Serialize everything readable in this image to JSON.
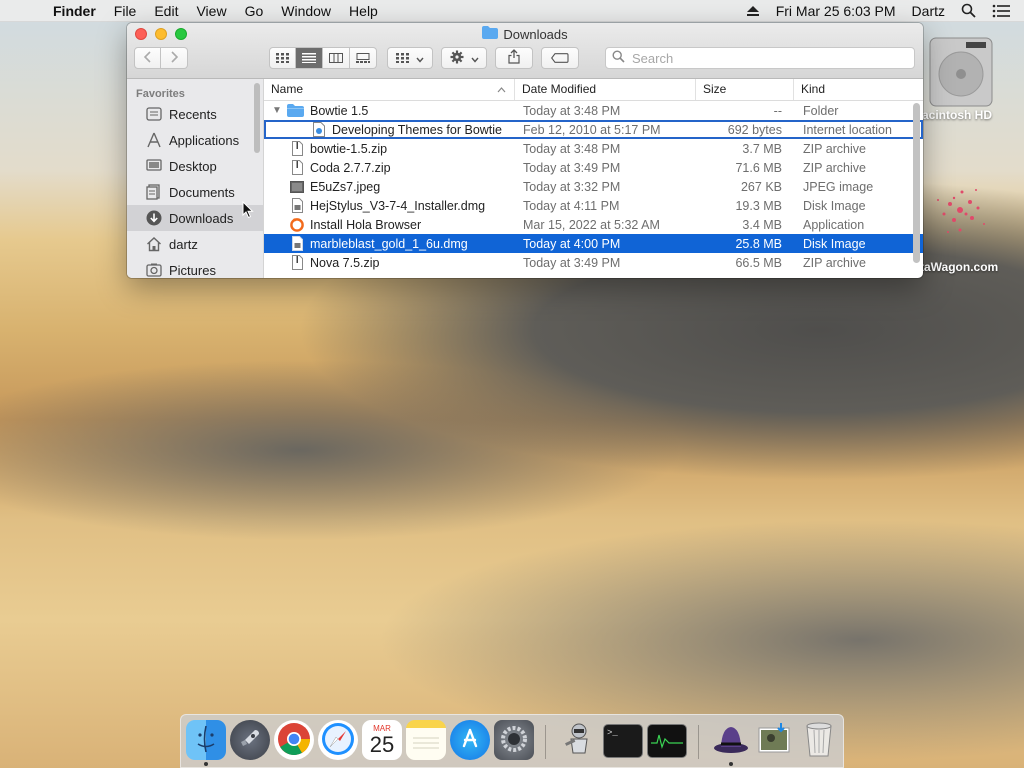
{
  "menubar": {
    "apple_glyph": "",
    "app_name": "Finder",
    "menus": [
      "File",
      "Edit",
      "View",
      "Go",
      "Window",
      "Help"
    ],
    "clock": "Fri Mar 25  6:03 PM",
    "user": "Dartz"
  },
  "desktop": {
    "disk_label": "acintosh HD",
    "watermark": "taWagon.com"
  },
  "window": {
    "title": "Downloads",
    "search_placeholder": "Search",
    "sidebar": {
      "header": "Favorites",
      "items": [
        {
          "label": "Recents",
          "icon": "recents-icon"
        },
        {
          "label": "Applications",
          "icon": "applications-icon"
        },
        {
          "label": "Desktop",
          "icon": "desktop-icon"
        },
        {
          "label": "Documents",
          "icon": "documents-icon"
        },
        {
          "label": "Downloads",
          "icon": "downloads-icon",
          "selected": true
        },
        {
          "label": "dartz",
          "icon": "home-icon"
        },
        {
          "label": "Pictures",
          "icon": "pictures-icon"
        }
      ]
    },
    "columns": [
      "Name",
      "Date Modified",
      "Size",
      "Kind"
    ],
    "rows": [
      {
        "name": "Bowtie 1.5",
        "date": "Today at 3:48 PM",
        "size": "--",
        "kind": "Folder",
        "type": "folder",
        "disclosure": "▼"
      },
      {
        "name": "Developing Themes for Bowtie",
        "date": "Feb 12, 2010 at 5:17 PM",
        "size": "692 bytes",
        "kind": "Internet location",
        "type": "location"
      },
      {
        "name": "bowtie-1.5.zip",
        "date": "Today at 3:48 PM",
        "size": "3.7 MB",
        "kind": "ZIP archive",
        "type": "zip"
      },
      {
        "name": "Coda 2.7.7.zip",
        "date": "Today at 3:49 PM",
        "size": "71.6 MB",
        "kind": "ZIP archive",
        "type": "zip"
      },
      {
        "name": "E5uZs7.jpeg",
        "date": "Today at 3:32 PM",
        "size": "267 KB",
        "kind": "JPEG image",
        "type": "image"
      },
      {
        "name": "HejStylus_V3-7-4_Installer.dmg",
        "date": "Today at 4:11 PM",
        "size": "19.3 MB",
        "kind": "Disk Image",
        "type": "dmg"
      },
      {
        "name": "Install Hola Browser",
        "date": "Mar 15, 2022 at 5:32 AM",
        "size": "3.4 MB",
        "kind": "Application",
        "type": "app"
      },
      {
        "name": "marbleblast_gold_1_6u.dmg",
        "date": "Today at 4:00 PM",
        "size": "25.8 MB",
        "kind": "Disk Image",
        "type": "dmg"
      },
      {
        "name": "Nova 7.5.zip",
        "date": "Today at 3:49 PM",
        "size": "66.5 MB",
        "kind": "ZIP archive",
        "type": "zip"
      }
    ]
  },
  "dock": {
    "calendar_month": "MAR",
    "calendar_day": "25",
    "items": [
      "Finder",
      "Launchpad",
      "Chrome",
      "Safari",
      "Calendar",
      "Notes",
      "App Store",
      "System Preferences",
      "Automator",
      "Terminal",
      "Activity Monitor",
      "Alfred",
      "Preview",
      "Trash"
    ]
  },
  "colors": {
    "selection": "#1064d6",
    "folder": "#5aa9f0"
  }
}
